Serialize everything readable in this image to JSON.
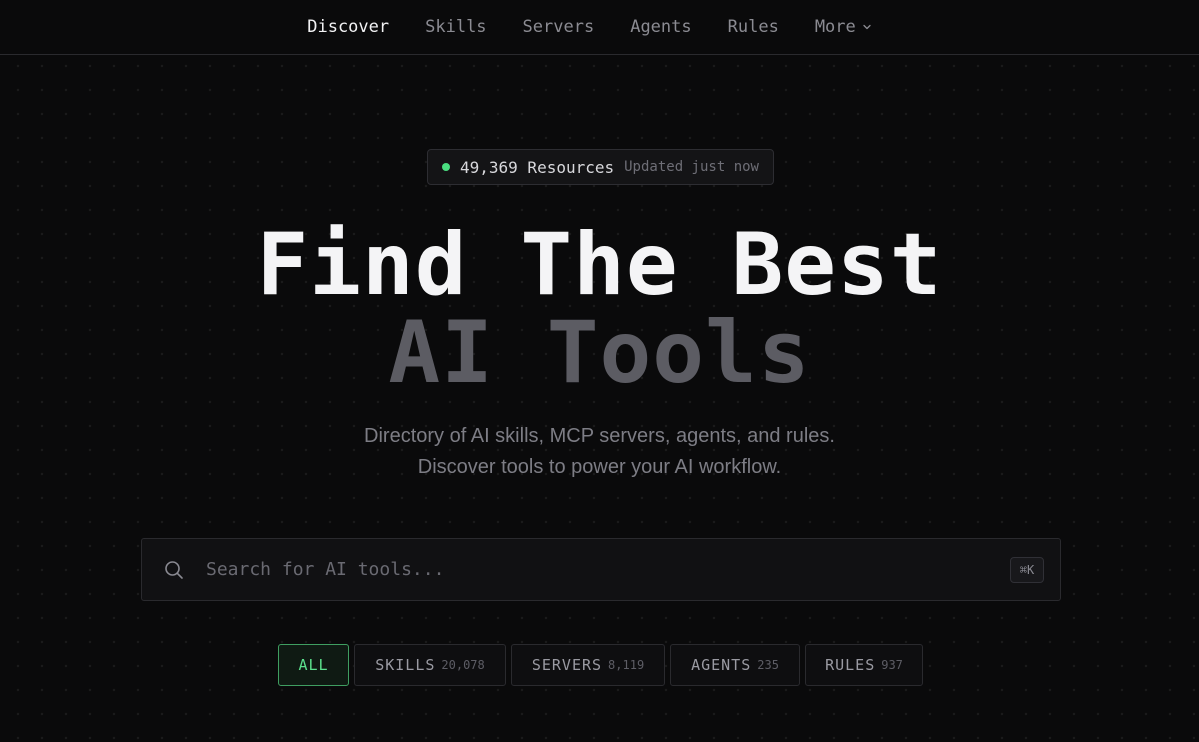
{
  "nav": {
    "items": [
      {
        "label": "Discover",
        "active": true
      },
      {
        "label": "Skills"
      },
      {
        "label": "Servers"
      },
      {
        "label": "Agents"
      },
      {
        "label": "Rules"
      },
      {
        "label": "More",
        "icon": "chevron-down-icon"
      }
    ]
  },
  "badge": {
    "count": "49,369 Resources",
    "updated": "Updated just now",
    "status_color": "#4ade80"
  },
  "hero": {
    "title_line1": "Find The Best",
    "title_line2": "AI Tools",
    "subtitle_line1": "Directory of AI skills, MCP servers, agents, and rules.",
    "subtitle_line2": "Discover tools to power your AI workflow."
  },
  "search": {
    "placeholder": "Search for AI tools...",
    "value": "",
    "shortcut": "⌘K",
    "icon": "search-icon"
  },
  "filters": [
    {
      "label": "ALL",
      "count": "",
      "active": true
    },
    {
      "label": "SKILLS",
      "count": "20,078"
    },
    {
      "label": "SERVERS",
      "count": "8,119"
    },
    {
      "label": "AGENTS",
      "count": "235"
    },
    {
      "label": "RULES",
      "count": "937"
    }
  ],
  "colors": {
    "background": "#0a0a0b",
    "accent_green": "#5be08c",
    "muted_title": "#5c5c63"
  }
}
